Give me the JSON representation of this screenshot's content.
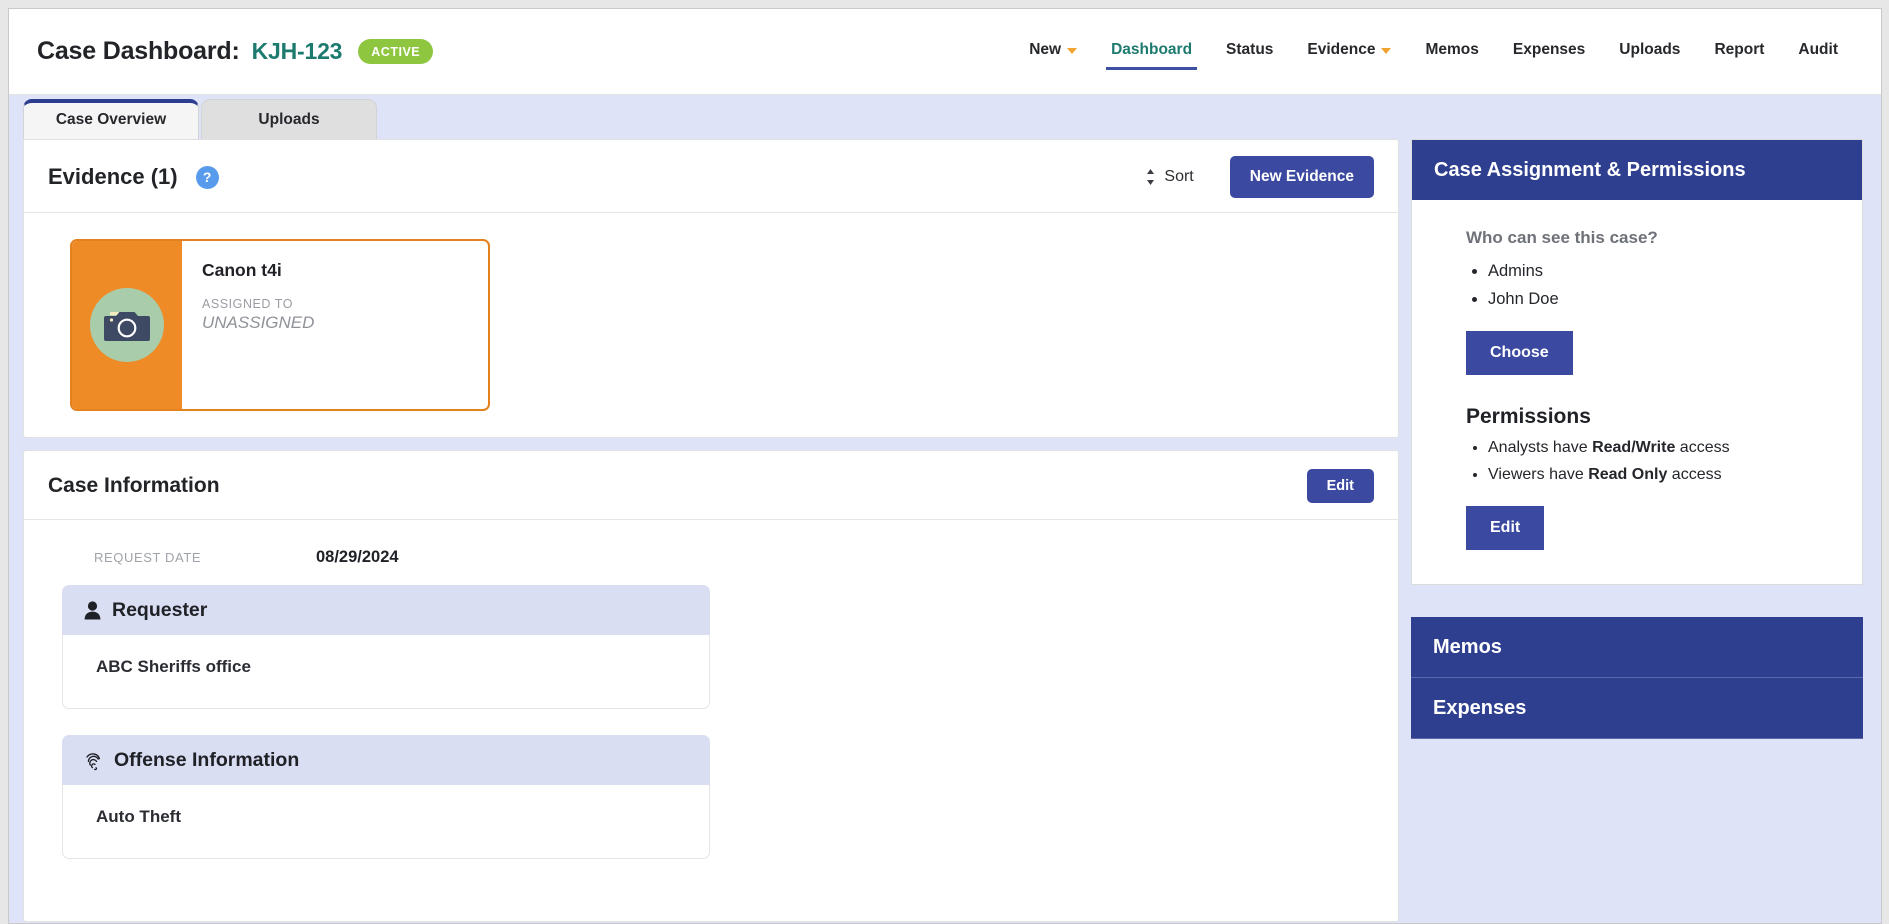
{
  "header": {
    "title_prefix": "Case Dashboard:",
    "case_number": "KJH-123",
    "status": "ACTIVE",
    "status_color": "#8fc640",
    "nav": [
      {
        "label": "New",
        "caret": true,
        "active": false
      },
      {
        "label": "Dashboard",
        "caret": false,
        "active": true
      },
      {
        "label": "Status",
        "caret": false,
        "active": false
      },
      {
        "label": "Evidence",
        "caret": true,
        "active": false
      },
      {
        "label": "Memos",
        "caret": false,
        "active": false
      },
      {
        "label": "Expenses",
        "caret": false,
        "active": false
      },
      {
        "label": "Uploads",
        "caret": false,
        "active": false
      },
      {
        "label": "Report",
        "caret": false,
        "active": false
      },
      {
        "label": "Audit",
        "caret": false,
        "active": false
      }
    ]
  },
  "tabs": [
    {
      "label": "Case Overview",
      "active": true
    },
    {
      "label": "Uploads",
      "active": false
    }
  ],
  "evidence": {
    "title": "Evidence (1)",
    "help_icon": "question-mark-icon",
    "sort_label": "Sort",
    "new_button": "New Evidence",
    "items": [
      {
        "name": "Canon t4i",
        "assigned_label": "ASSIGNED TO",
        "assignee": "UNASSIGNED",
        "icon": "camera-icon",
        "accent_color": "#ef8b27"
      }
    ]
  },
  "case_information": {
    "title": "Case Information",
    "edit_button": "Edit",
    "request_date_label": "REQUEST DATE",
    "request_date_value": "08/29/2024",
    "groups": [
      {
        "icon": "person-icon",
        "heading": "Requester",
        "value": "ABC Sheriffs office"
      },
      {
        "icon": "fingerprint-icon",
        "heading": "Offense Information",
        "value": "Auto Theft"
      }
    ]
  },
  "sidebar": {
    "assignment": {
      "heading": "Case Assignment & Permissions",
      "question": "Who can see this case?",
      "viewers": [
        "Admins",
        "John Doe"
      ],
      "choose_button": "Choose",
      "permissions_title": "Permissions",
      "permissions": [
        {
          "prefix": "Analysts have ",
          "strong": "Read/Write",
          "suffix": " access"
        },
        {
          "prefix": "Viewers have ",
          "strong": "Read Only",
          "suffix": " access"
        }
      ],
      "edit_button": "Edit"
    },
    "collapsed": [
      {
        "label": "Memos"
      },
      {
        "label": "Expenses"
      }
    ]
  },
  "colors": {
    "brand_blue": "#2f3f8f",
    "button_blue": "#3b4aa0",
    "teal": "#1d7a6e",
    "orange": "#ef8b27",
    "page_bg": "#dfe3f7"
  }
}
